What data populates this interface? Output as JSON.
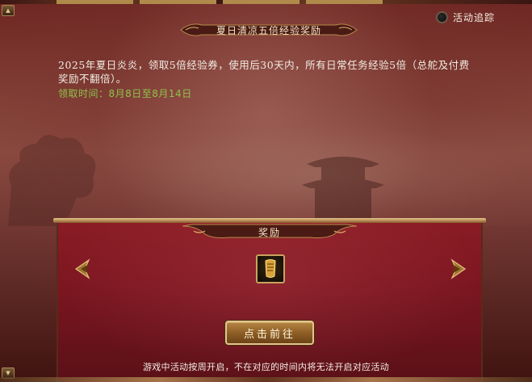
{
  "event": {
    "title": "夏日清凉五倍经验奖励",
    "description": "2025年夏日炎炎，领取5倍经验券，使用后30天内，所有日常任务经验5倍（总舵及付费奖励不翻倍）。",
    "period_label": "领取时间：",
    "period_value": "8月8日至8月14日"
  },
  "tracker": {
    "label": "活动追踪",
    "checked": false
  },
  "reward": {
    "header": "奖励",
    "items": [
      {
        "icon": "gold-scroll-icon"
      }
    ]
  },
  "actions": {
    "go_label": "点击前往"
  },
  "footer": {
    "notice": "游戏中活动按周开启，不在对应的时间内将无法开启对应活动"
  },
  "colors": {
    "accent_gold": "#c7a35c",
    "period_green": "#8ec34a",
    "reward_panel": "#7a1620"
  }
}
